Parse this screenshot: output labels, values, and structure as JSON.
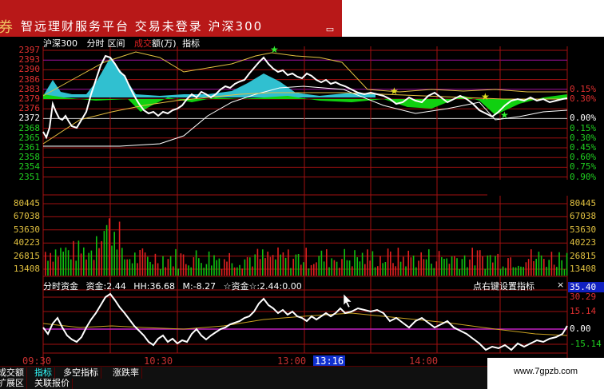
{
  "window": {
    "logo_char": "券",
    "title": "智远理财服务平台  交易未登录  沪深300",
    "restore_icon": "restore-window-icon"
  },
  "chart_header": {
    "symbol": "沪深300",
    "mode": "分时",
    "range": "区间",
    "vol_label_a": "成交",
    "vol_label_b": "额(万)",
    "indicator": "指标"
  },
  "price_axis_left": [
    "2397",
    "2393",
    "2390",
    "2386",
    "2383",
    "2379",
    "2376",
    "2372",
    "2368",
    "2365",
    "2361",
    "2358",
    "2354",
    "2351"
  ],
  "pct_axis_right": [
    "0.15%",
    "0.30%",
    "0.00%",
    "0.15%",
    "0.30%",
    "0.45%",
    "0.60%",
    "0.75%",
    "0.90%"
  ],
  "volume_axis_left": [
    "80445",
    "67038",
    "53630",
    "40223",
    "26815",
    "13408"
  ],
  "volume_axis_right": [
    "80445",
    "67038",
    "53630",
    "40223",
    "26815",
    "13408"
  ],
  "indicator_header": {
    "name": "分时资金",
    "fund": "资金:2.44",
    "hh": "HH:36.68",
    "m": "M:-8.27",
    "star": "☆资金☆:2.44",
    "zero": ":0.00"
  },
  "indicator_hint": "点右键设置指标",
  "indicator_close": "×",
  "indicator_current": "35.40",
  "indicator_axis_right": [
    "30.29",
    "15.14",
    "0.00",
    "-15.14"
  ],
  "time_axis": [
    "09:30",
    "10:30",
    "13:00",
    "13:16",
    "14:00"
  ],
  "tabs_row1": [
    "成交额",
    "指标",
    "多空指标",
    "涨跌率"
  ],
  "tabs_row1_active": "指标",
  "tabs_row2": [
    "扩展区",
    "关联报价"
  ],
  "watermark": "www.7gpzb.com",
  "colors": {
    "grid_red": "#a01010",
    "price_line": "#ffffff",
    "avg_line": "#e8c040",
    "cyan_fill": "#30c0d0",
    "green_fill": "#10d010",
    "vol_red": "#e02020",
    "vol_green": "#10c010",
    "indicator_ma": "#c8a020",
    "zero_line": "#c020c0"
  }
}
